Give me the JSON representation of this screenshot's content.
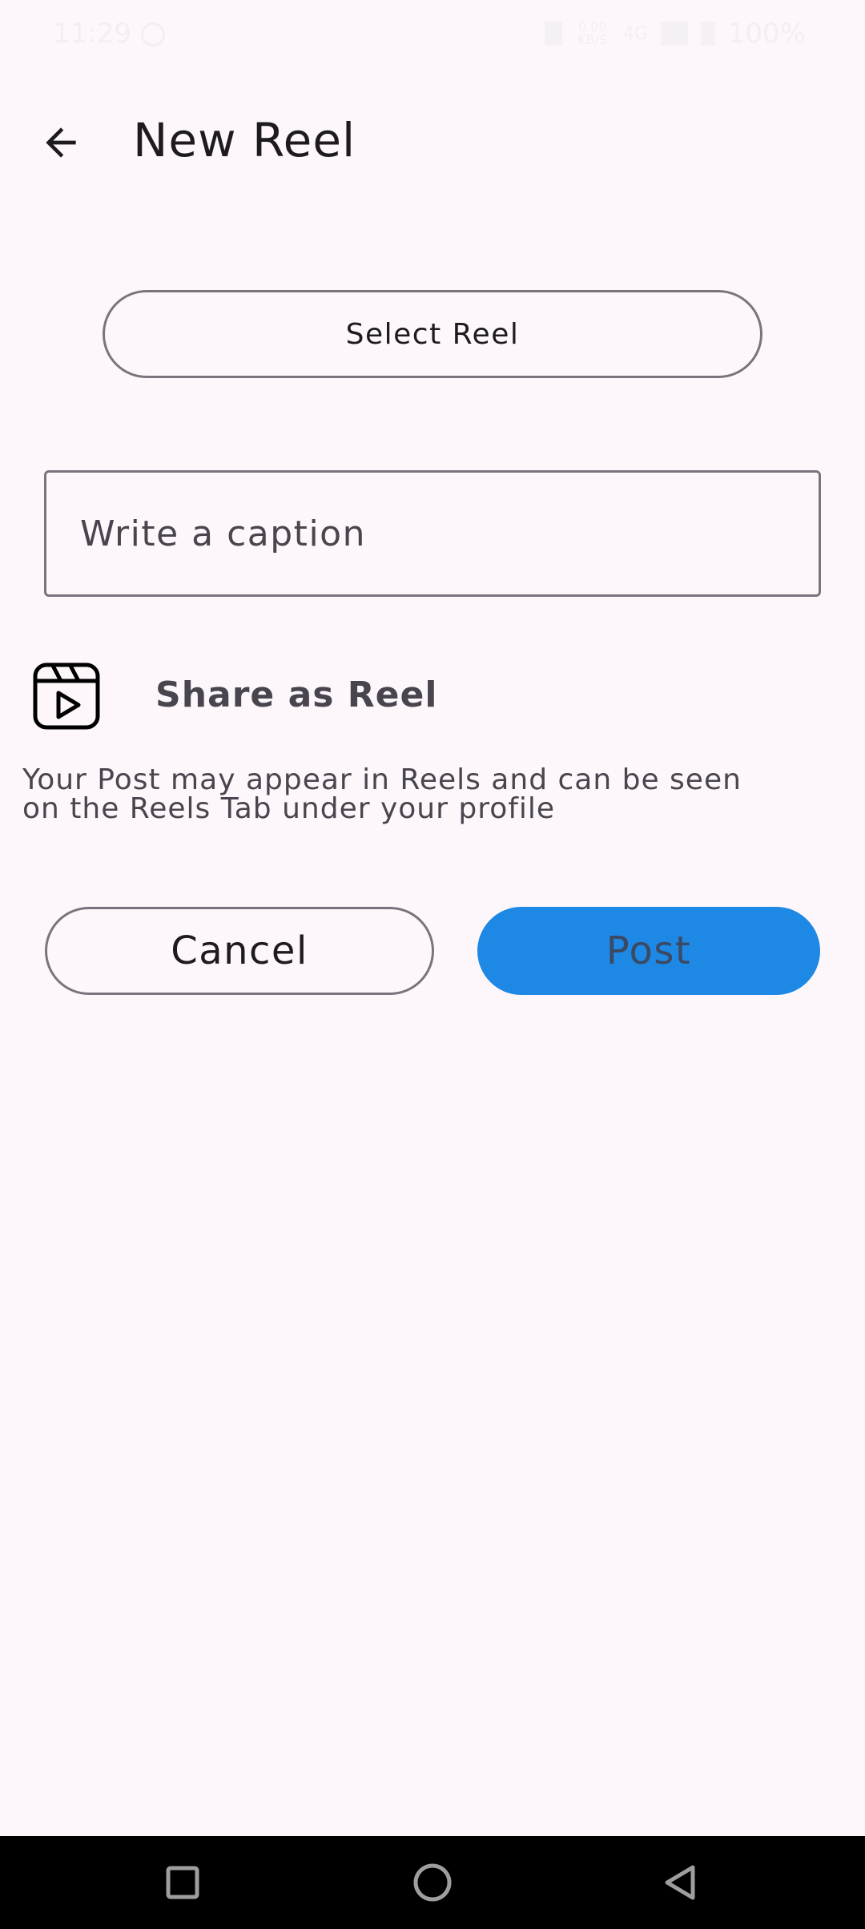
{
  "status_bar": {
    "time": "11:29",
    "network_speed": "0.00 KB/S",
    "network_type": "4G",
    "battery": "100%"
  },
  "app_bar": {
    "title": "New Reel",
    "back_icon": "arrow-back-icon"
  },
  "select_reel": {
    "label": "Select Reel"
  },
  "caption": {
    "placeholder": "Write a caption",
    "value": ""
  },
  "share": {
    "icon": "reel-icon",
    "label": "Share as Reel",
    "description_line1": "Your Post may appear in Reels and can be seen",
    "description_line2": "on the Reels Tab under your profile"
  },
  "actions": {
    "cancel_label": "Cancel",
    "post_label": "Post"
  },
  "colors": {
    "background": "#fdf7fb",
    "post_button": "#1e88e5",
    "outline": "#79747e",
    "nav_bar": "#000000"
  },
  "nav": {
    "recents_icon": "square-recents-icon",
    "home_icon": "circle-home-icon",
    "back_icon": "triangle-back-icon"
  }
}
